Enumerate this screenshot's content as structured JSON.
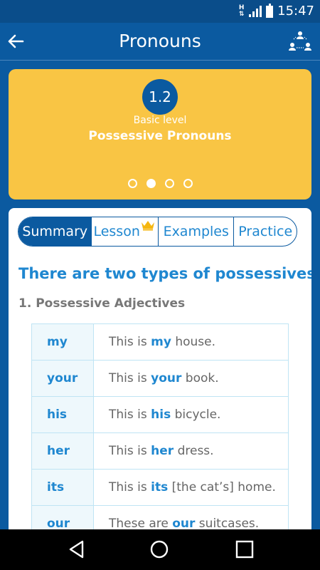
{
  "status": {
    "time": "15:47",
    "sim_label": "H"
  },
  "appbar": {
    "title": "Pronouns"
  },
  "level": {
    "number": "1.2",
    "level_name": "Basic level",
    "title": "Possessive Pronouns",
    "pages": 4,
    "active_page": 2
  },
  "tabs": [
    {
      "label": "Summary",
      "active": true
    },
    {
      "label": "Lesson",
      "premium": true
    },
    {
      "label": "Examples"
    },
    {
      "label": "Practice"
    }
  ],
  "content": {
    "heading": "There are two types of possessives:",
    "subheading": "1. Possessive Adjectives",
    "rows": [
      {
        "pronoun": "my",
        "before": "This is ",
        "word": "my",
        "after": " house."
      },
      {
        "pronoun": "your",
        "before": "This is ",
        "word": "your",
        "after": " book."
      },
      {
        "pronoun": "his",
        "before": "This is ",
        "word": "his",
        "after": " bicycle."
      },
      {
        "pronoun": "her",
        "before": "This is ",
        "word": "her",
        "after": " dress."
      },
      {
        "pronoun": "its",
        "before": "This is ",
        "word": "its",
        "after": " [the cat’s] home."
      },
      {
        "pronoun": "our",
        "before": "These are ",
        "word": "our",
        "after": " suitcases."
      }
    ]
  },
  "colors": {
    "primary": "#0b5aa0",
    "accent": "#1f87d0",
    "card": "#f9c544"
  },
  "icons": {
    "back": "arrow-left-icon",
    "community": "community-icon",
    "crown": "crown-icon",
    "nav_back": "triangle-back-icon",
    "nav_home": "circle-home-icon",
    "nav_recent": "square-recent-icon"
  }
}
